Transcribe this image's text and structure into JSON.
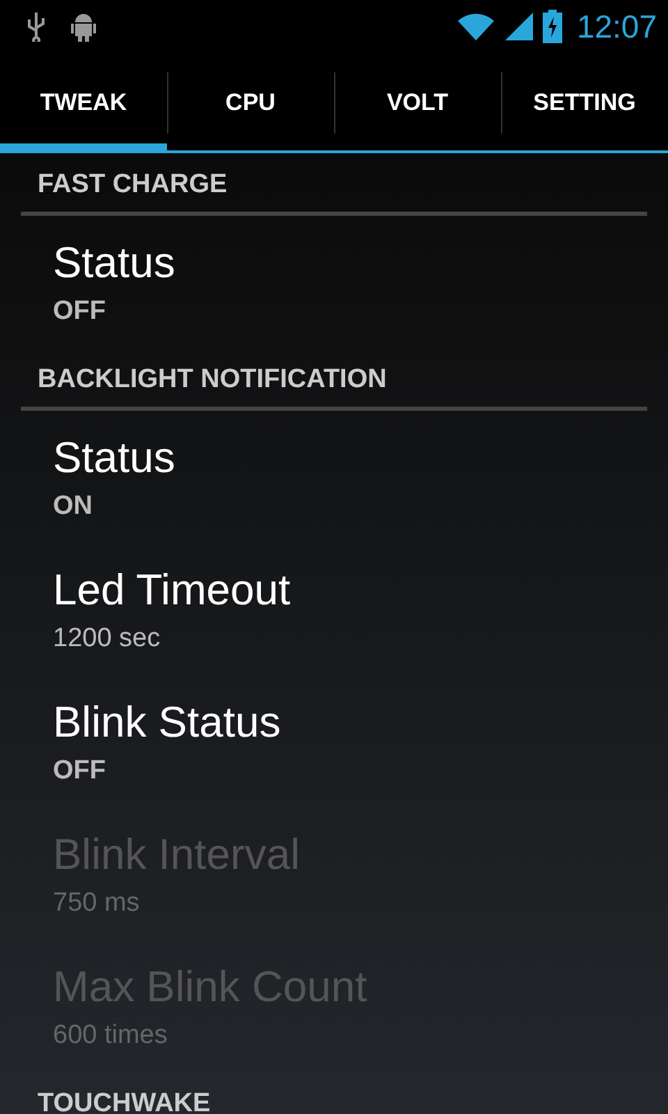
{
  "status_bar": {
    "time": "12:07"
  },
  "tabs": [
    {
      "label": "TWEAK",
      "selected": true
    },
    {
      "label": "CPU",
      "selected": false
    },
    {
      "label": "VOLT",
      "selected": false
    },
    {
      "label": "SETTING",
      "selected": false
    }
  ],
  "sections": [
    {
      "title": "FAST CHARGE",
      "items": [
        {
          "title": "Status",
          "summary": "OFF",
          "disabled": false,
          "kind": "state"
        }
      ]
    },
    {
      "title": "BACKLIGHT NOTIFICATION",
      "items": [
        {
          "title": "Status",
          "summary": "ON",
          "disabled": false,
          "kind": "state"
        },
        {
          "title": "Led Timeout",
          "summary": "1200 sec",
          "disabled": false,
          "kind": "value"
        },
        {
          "title": "Blink Status",
          "summary": "OFF",
          "disabled": false,
          "kind": "state"
        },
        {
          "title": "Blink Interval",
          "summary": "750 ms",
          "disabled": true,
          "kind": "value"
        },
        {
          "title": "Max Blink Count",
          "summary": "600 times",
          "disabled": true,
          "kind": "value"
        }
      ]
    },
    {
      "title": "TOUCHWAKE"
    }
  ]
}
